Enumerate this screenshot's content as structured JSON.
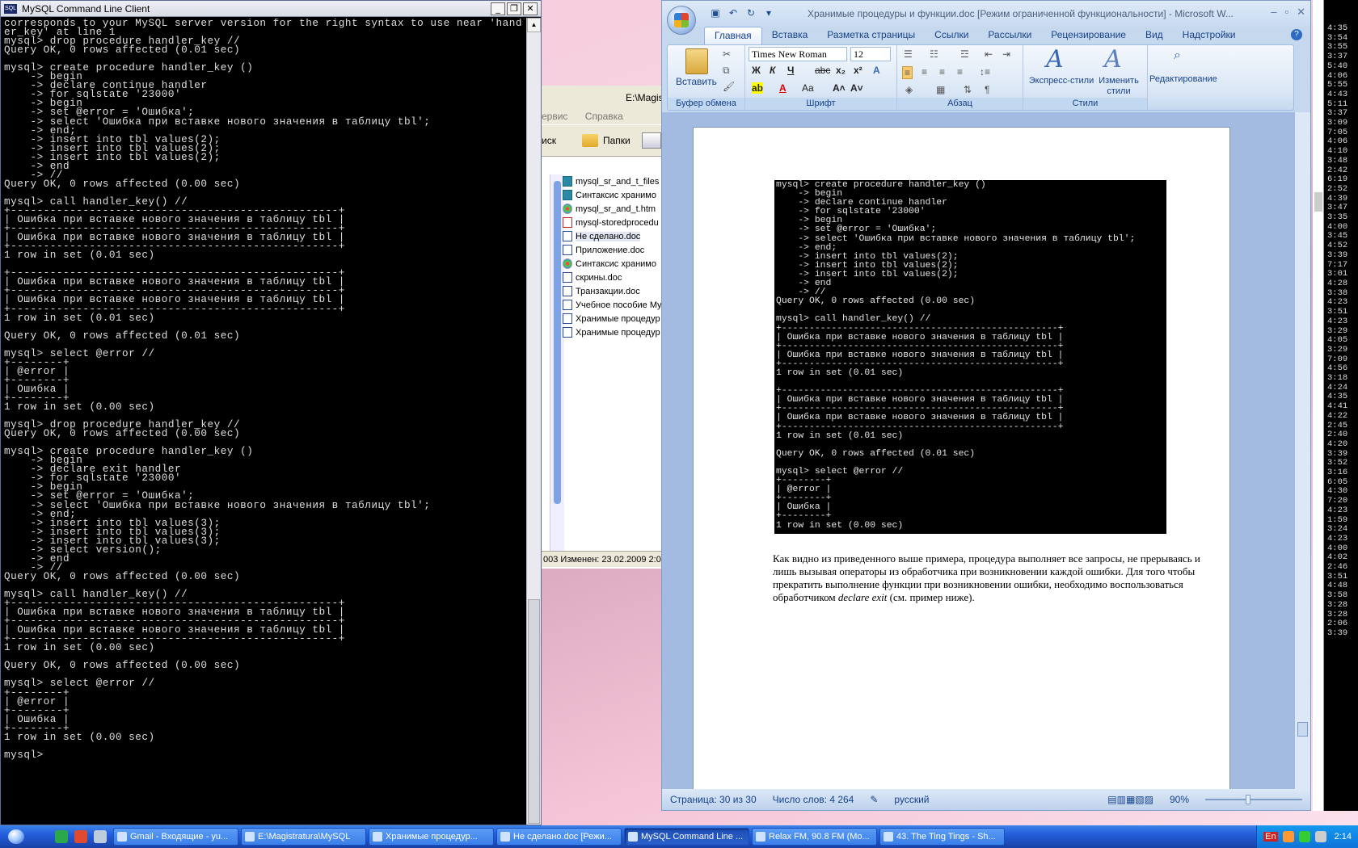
{
  "console": {
    "title": "MySQL Command Line Client",
    "lines": [
      "corresponds to your MySQL server version for the right syntax to use near 'handl",
      "er_key' at line 1",
      "mysql> drop procedure handler_key //",
      "Query OK, 0 rows affected (0.01 sec)",
      "",
      "mysql> create procedure handler_key ()",
      "    -> begin",
      "    -> declare continue handler",
      "    -> for sqlstate '23000'",
      "    -> begin",
      "    -> set @error = 'Ошибка';",
      "    -> select 'Ошибка при вставке нового значения в таблицу tbl';",
      "    -> end;",
      "    -> insert into tbl values(2);",
      "    -> insert into tbl values(2);",
      "    -> insert into tbl values(2);",
      "    -> end",
      "    -> //",
      "Query OK, 0 rows affected (0.00 sec)",
      "",
      "mysql> call handler_key() //",
      "+--------------------------------------------------+",
      "| Ошибка при вставке нового значения в таблицу tbl |",
      "+--------------------------------------------------+",
      "| Ошибка при вставке нового значения в таблицу tbl |",
      "+--------------------------------------------------+",
      "1 row in set (0.01 sec)",
      "",
      "+--------------------------------------------------+",
      "| Ошибка при вставке нового значения в таблицу tbl |",
      "+--------------------------------------------------+",
      "| Ошибка при вставке нового значения в таблицу tbl |",
      "+--------------------------------------------------+",
      "1 row in set (0.01 sec)",
      "",
      "Query OK, 0 rows affected (0.01 sec)",
      "",
      "mysql> select @error //",
      "+--------+",
      "| @error |",
      "+--------+",
      "| Ошибка |",
      "+--------+",
      "1 row in set (0.00 sec)",
      "",
      "mysql> drop procedure handler_key //",
      "Query OK, 0 rows affected (0.00 sec)",
      "",
      "mysql> create procedure handler_key ()",
      "    -> begin",
      "    -> declare exit handler",
      "    -> for sqlstate '23000'",
      "    -> begin",
      "    -> set @error = 'Ошибка';",
      "    -> select 'Ошибка при вставке нового значения в таблицу tbl';",
      "    -> end;",
      "    -> insert into tbl values(3);",
      "    -> insert into tbl values(3);",
      "    -> insert into tbl values(3);",
      "    -> select version();",
      "    -> end",
      "    -> //",
      "Query OK, 0 rows affected (0.00 sec)",
      "",
      "mysql> call handler_key() //",
      "+--------------------------------------------------+",
      "| Ошибка при вставке нового значения в таблицу tbl |",
      "+--------------------------------------------------+",
      "| Ошибка при вставке нового значения в таблицу tbl |",
      "+--------------------------------------------------+",
      "1 row in set (0.00 sec)",
      "",
      "Query OK, 0 rows affected (0.00 sec)",
      "",
      "mysql> select @error //",
      "+--------+",
      "| @error |",
      "+--------+",
      "| Ошибка |",
      "+--------+",
      "1 row in set (0.00 sec)",
      "",
      "mysql> "
    ]
  },
  "explorer": {
    "path": "E:\\Magist",
    "menu": [
      "ервис",
      "Справка"
    ],
    "search_label": "иск",
    "folders_label": "Папки",
    "files": [
      {
        "name": "mysql_sr_and_t_files",
        "type": "folder"
      },
      {
        "name": "Синтаксис хранимо",
        "type": "folder"
      },
      {
        "name": "mysql_sr_and_t.htm",
        "type": "htm"
      },
      {
        "name": "mysql-storedprocedu",
        "type": "pdf"
      },
      {
        "name": "Не сделано.doc",
        "type": "doc",
        "selected": true
      },
      {
        "name": "Приложение.doc",
        "type": "doc"
      },
      {
        "name": "Синтаксис хранимо",
        "type": "htm"
      },
      {
        "name": "скрины.doc",
        "type": "doc"
      },
      {
        "name": "Транзакции.doc",
        "type": "doc"
      },
      {
        "name": "Учебное пособие My",
        "type": "doc"
      },
      {
        "name": "Хранимые процедур",
        "type": "doc"
      },
      {
        "name": "Хранимые процедур",
        "type": "doc"
      }
    ],
    "status": "003 Изменен: 23.02.2009 2:0"
  },
  "word": {
    "title": "Хранимые процедуры и функции.doc [Режим ограниченной функциональности] - Microsoft W...",
    "tabs": [
      "Главная",
      "Вставка",
      "Разметка страницы",
      "Ссылки",
      "Рассылки",
      "Рецензирование",
      "Вид",
      "Надстройки"
    ],
    "active_tab": "Главная",
    "groups": {
      "clipboard": "Буфер обмена",
      "font": "Шрифт",
      "paragraph": "Абзац",
      "styles": "Стили"
    },
    "paste_label": "Вставить",
    "font_name": "Times New Roman",
    "font_size": "12",
    "express_styles": "Экспресс-стили",
    "change_styles_1": "Изменить",
    "change_styles_2": "стили",
    "editing": "Редактирование",
    "screenshot_lines": [
      "mysql> create procedure handler_key ()",
      "    -> begin",
      "    -> declare continue handler",
      "    -> for sqlstate '23000'",
      "    -> begin",
      "    -> set @error = 'Ошибка';",
      "    -> select 'Ошибка при вставке нового значения в таблицу tbl';",
      "    -> end;",
      "    -> insert into tbl values(2);",
      "    -> insert into tbl values(2);",
      "    -> insert into tbl values(2);",
      "    -> end",
      "    -> //",
      "Query OK, 0 rows affected (0.00 sec)",
      "",
      "mysql> call handler_key() //",
      "+--------------------------------------------------+",
      "| Ошибка при вставке нового значения в таблицу tbl |",
      "+--------------------------------------------------+",
      "| Ошибка при вставке нового значения в таблицу tbl |",
      "+--------------------------------------------------+",
      "1 row in set (0.01 sec)",
      "",
      "+--------------------------------------------------+",
      "| Ошибка при вставке нового значения в таблицу tbl |",
      "+--------------------------------------------------+",
      "| Ошибка при вставке нового значения в таблицу tbl |",
      "+--------------------------------------------------+",
      "1 row in set (0.01 sec)",
      "",
      "Query OK, 0 rows affected (0.01 sec)",
      "",
      "mysql> select @error //",
      "+--------+",
      "| @error |",
      "+--------+",
      "| Ошибка |",
      "+--------+",
      "1 row in set (0.00 sec)"
    ],
    "paragraph_before": "Как видно из приведенного выше примера, процедура выполняет все запросы, не прерываясь и лишь вызывая операторы из обработчика при возникновении каждой ошибки. Для того чтобы прекратить выполнение функции при возникновении ошибки, необходимо воспользоваться обработчиком ",
    "paragraph_em": "declare exit",
    "paragraph_after": " (см. пример ниже).",
    "status": {
      "page": "Страница: 30 из 30",
      "words": "Число слов: 4 264",
      "language": "русский",
      "zoom": "90%"
    }
  },
  "log_times": [
    "4:35",
    "3:54",
    "3:55",
    "3:37",
    "5:40",
    "4:06",
    "5:55",
    "4:43",
    "5:11",
    "3:37",
    "3:09",
    "7:05",
    "4:06",
    "4:10",
    "3:48",
    "2:42",
    "6:19",
    "2:52",
    "4:39",
    "3:47",
    "3:35",
    "4:00",
    "3:45",
    "4:52",
    "3:39",
    "7:17",
    "3:01",
    "4:28",
    "3:38",
    "4:23",
    "3:51",
    "4:23",
    "3:29",
    "4:05",
    "3:29",
    "7:09",
    "4:56",
    "3:18",
    "4:24",
    "4:35",
    "4:41",
    "4:22",
    "2:45",
    "2:40",
    "4:20",
    "3:39",
    "3:52",
    "3:16",
    "6:05",
    "4:30",
    "7:20",
    "4:23",
    "1:59",
    "3:24",
    "4:23",
    "4:00",
    "4:02",
    "2:46",
    "3:51",
    "4:48",
    "3:58",
    "3:28",
    "3:28",
    "2:06",
    "3:39"
  ],
  "taskbar": {
    "buttons": [
      {
        "label": "Gmail - Входящие - yu...",
        "active": false
      },
      {
        "label": "E:\\Magistratura\\MySQL",
        "active": false
      },
      {
        "label": "Хранимые процедур...",
        "active": false
      },
      {
        "label": "Не сделано.doc [Режи...",
        "active": false
      },
      {
        "label": "MySQL Command Line ...",
        "active": true
      },
      {
        "label": "Relax FM, 90.8 FM (Mo...",
        "active": false
      },
      {
        "label": "43. The Ting Tings - Sh...",
        "active": false
      }
    ],
    "lang": "En",
    "clock": "2:14"
  }
}
